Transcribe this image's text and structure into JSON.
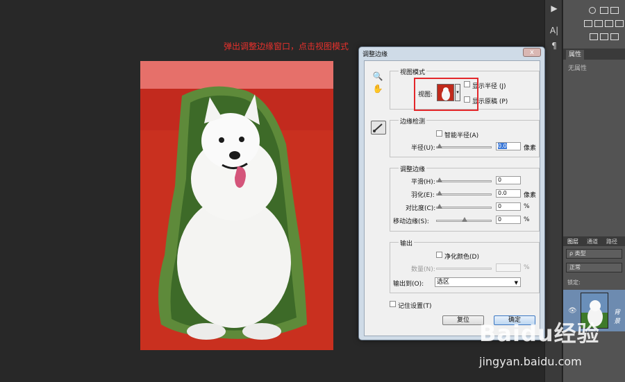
{
  "annotation": {
    "text": "弹出调整边缘窗口，点击视图模式",
    "color": "#e8312c"
  },
  "dialog": {
    "title": "调整边缘",
    "close_label": "x",
    "view_mode": {
      "group_label": "视图模式",
      "view_label": "视图:",
      "show_radius": "显示半径 (J)",
      "show_original": "显示原稿 (P)"
    },
    "edge_detection": {
      "group_label": "边缘检测",
      "smart_radius": "智能半径(A)",
      "radius_label": "半径(U):",
      "radius_value": "0.0",
      "radius_unit": "像素",
      "radius_level": 0
    },
    "adjust_edge": {
      "group_label": "调整边缘",
      "rows": [
        {
          "label": "平滑(H):",
          "value": "0",
          "unit": "",
          "level": 0
        },
        {
          "label": "羽化(E):",
          "value": "0.0",
          "unit": "像素",
          "level": 0
        },
        {
          "label": "对比度(C):",
          "value": "0",
          "unit": "%",
          "level": 0
        },
        {
          "label": "移动边缘(S):",
          "value": "0",
          "unit": "%",
          "level": 0.5
        }
      ]
    },
    "output": {
      "group_label": "输出",
      "decontaminate": "净化颜色(D)",
      "amount_label": "数量(N):",
      "amount_unit": "%",
      "output_to_label": "输出到(O):",
      "output_to_value": "选区"
    },
    "remember": "记住设置(T)",
    "reset_button": "复位",
    "ok_button": "确定",
    "accent": "#3a76c1"
  },
  "ps": {
    "properties_tab": "属性",
    "properties_empty": "无属性",
    "layer_tabs": [
      "图层",
      "通道",
      "路径"
    ],
    "kind_select": "ρ 类型",
    "blend_select": "正常",
    "lock_label": "锁定:",
    "layer_name": "背景"
  },
  "watermark": {
    "logo": "Baidu经验",
    "url": "jingyan.baidu.com"
  }
}
